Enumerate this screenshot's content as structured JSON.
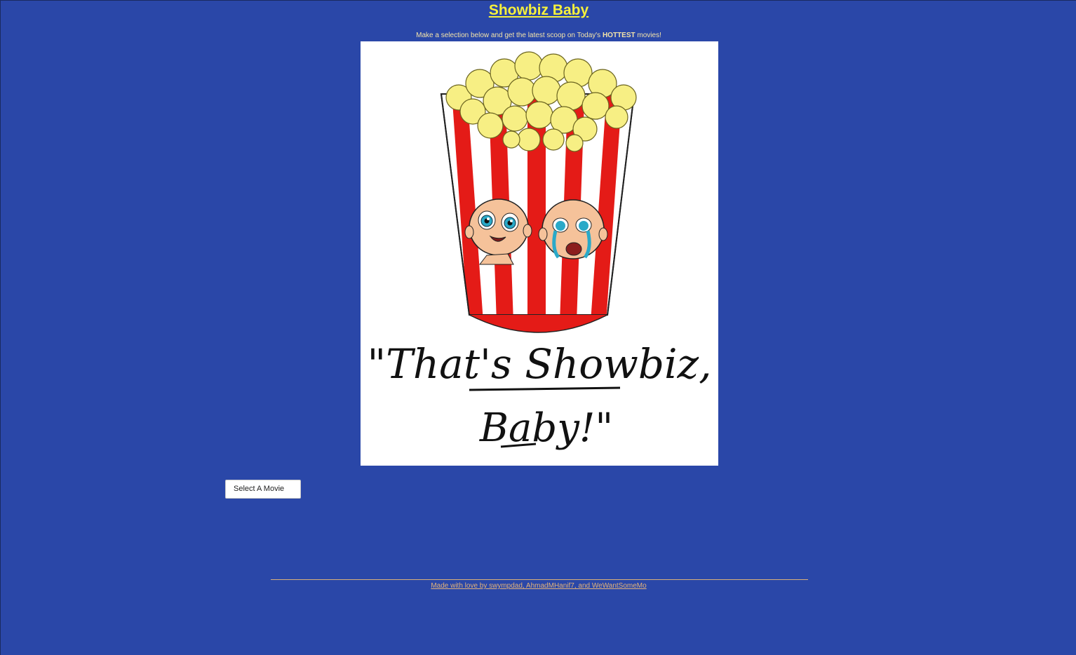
{
  "header": {
    "title": "Showbiz Baby",
    "subtitle_before": "Make a selection below and get the latest scoop on Today's ",
    "subtitle_bold": "HOTTEST",
    "subtitle_after": " movies!"
  },
  "hero": {
    "caption_line1": "\"That's Showbiz,",
    "caption_line2": "Baby!\""
  },
  "controls": {
    "select_label": "Select A Movie"
  },
  "footer": {
    "credit": "Made with love by swympdad, AhmadMHanif7, and WeWantSomeMo"
  },
  "colors": {
    "background": "#2a47a8",
    "title": "#f5f03c",
    "subtitle": "#f3e3a8",
    "footer": "#e2b27a"
  }
}
